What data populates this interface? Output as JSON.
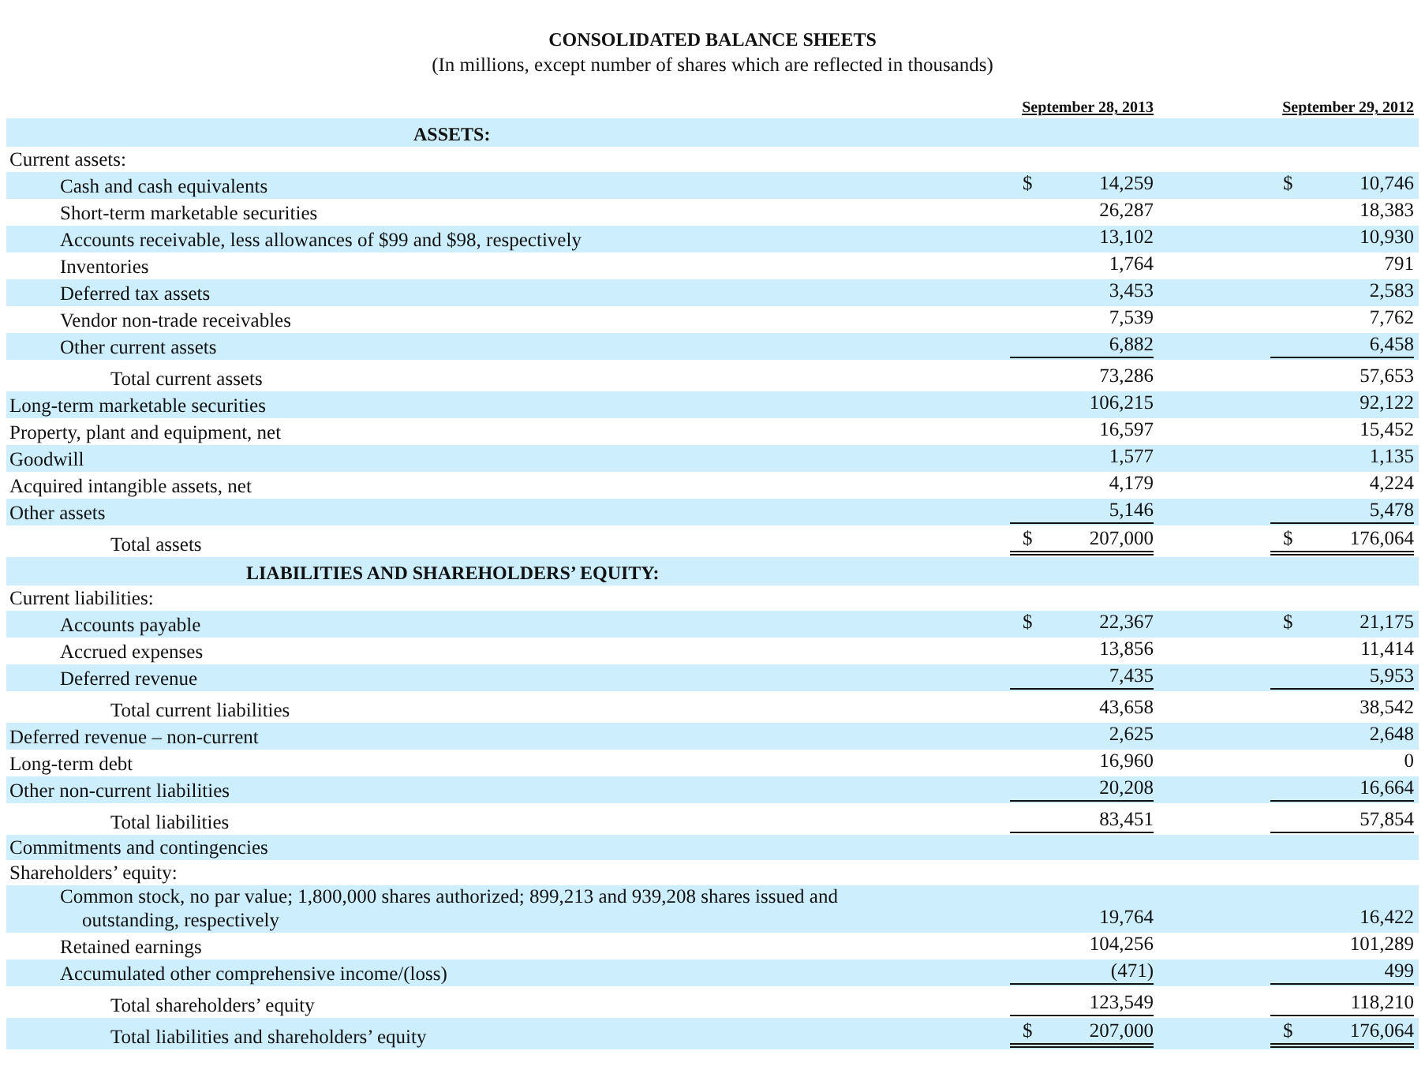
{
  "title": "CONSOLIDATED BALANCE SHEETS",
  "subtitle": "(In millions, except number of shares which are reflected in thousands)",
  "columns": [
    "September 28, 2013",
    "September 29, 2012"
  ],
  "rows": [
    {
      "kind": "section",
      "label": "ASSETS:"
    },
    {
      "kind": "group",
      "label": "Current assets:",
      "children": [
        {
          "kind": "line",
          "label": "Cash and cash equivalents",
          "underlined": false,
          "double_underlined": false,
          "values": [
            {
              "symbol": "$",
              "amount": "14,259"
            },
            {
              "symbol": "$",
              "amount": "10,746"
            }
          ]
        },
        {
          "kind": "line",
          "label": "Short-term marketable securities",
          "underlined": false,
          "double_underlined": false,
          "values": [
            {
              "amount": "26,287"
            },
            {
              "amount": "18,383"
            }
          ]
        },
        {
          "kind": "line",
          "label": "Accounts receivable, less allowances of $99 and $98, respectively",
          "underlined": false,
          "double_underlined": false,
          "values": [
            {
              "amount": "13,102"
            },
            {
              "amount": "10,930"
            }
          ]
        },
        {
          "kind": "line",
          "label": "Inventories",
          "underlined": false,
          "double_underlined": false,
          "values": [
            {
              "amount": "1,764"
            },
            {
              "amount": "791"
            }
          ]
        },
        {
          "kind": "line",
          "label": "Deferred tax assets",
          "underlined": false,
          "double_underlined": false,
          "values": [
            {
              "amount": "3,453"
            },
            {
              "amount": "2,583"
            }
          ]
        },
        {
          "kind": "line",
          "label": "Vendor non-trade receivables",
          "underlined": false,
          "double_underlined": false,
          "values": [
            {
              "amount": "7,539"
            },
            {
              "amount": "7,762"
            }
          ]
        },
        {
          "kind": "line",
          "label": "Other current assets",
          "underlined": true,
          "double_underlined": false,
          "values": [
            {
              "amount": "6,882"
            },
            {
              "amount": "6,458"
            }
          ]
        }
      ]
    },
    {
      "kind": "total",
      "label": "Total current assets",
      "underlined": false,
      "double_underlined": false,
      "values": [
        {
          "amount": "73,286"
        },
        {
          "amount": "57,653"
        }
      ]
    },
    {
      "kind": "line",
      "label": "Long-term marketable securities",
      "underlined": false,
      "double_underlined": false,
      "values": [
        {
          "amount": "106,215"
        },
        {
          "amount": "92,122"
        }
      ]
    },
    {
      "kind": "line",
      "label": "Property, plant and equipment, net",
      "underlined": false,
      "double_underlined": false,
      "values": [
        {
          "amount": "16,597"
        },
        {
          "amount": "15,452"
        }
      ]
    },
    {
      "kind": "line",
      "label": "Goodwill",
      "underlined": false,
      "double_underlined": false,
      "values": [
        {
          "amount": "1,577"
        },
        {
          "amount": "1,135"
        }
      ]
    },
    {
      "kind": "line",
      "label": "Acquired intangible assets, net",
      "underlined": false,
      "double_underlined": false,
      "values": [
        {
          "amount": "4,179"
        },
        {
          "amount": "4,224"
        }
      ]
    },
    {
      "kind": "line",
      "label": "Other assets",
      "underlined": true,
      "double_underlined": false,
      "values": [
        {
          "amount": "5,146"
        },
        {
          "amount": "5,478"
        }
      ]
    },
    {
      "kind": "total",
      "label": "Total assets",
      "underlined": false,
      "double_underlined": true,
      "values": [
        {
          "symbol": "$",
          "amount": "207,000"
        },
        {
          "symbol": "$",
          "amount": "176,064"
        }
      ]
    },
    {
      "kind": "section",
      "label": "LIABILITIES AND SHAREHOLDERS’ EQUITY:"
    },
    {
      "kind": "group",
      "label": "Current liabilities:",
      "children": [
        {
          "kind": "line",
          "label": "Accounts payable",
          "underlined": false,
          "double_underlined": false,
          "values": [
            {
              "symbol": "$",
              "amount": "22,367"
            },
            {
              "symbol": "$",
              "amount": "21,175"
            }
          ]
        },
        {
          "kind": "line",
          "label": "Accrued expenses",
          "underlined": false,
          "double_underlined": false,
          "values": [
            {
              "amount": "13,856"
            },
            {
              "amount": "11,414"
            }
          ]
        },
        {
          "kind": "line",
          "label": "Deferred revenue",
          "underlined": true,
          "double_underlined": false,
          "values": [
            {
              "amount": "7,435"
            },
            {
              "amount": "5,953"
            }
          ]
        }
      ]
    },
    {
      "kind": "total",
      "label": "Total current liabilities",
      "underlined": false,
      "double_underlined": false,
      "values": [
        {
          "amount": "43,658"
        },
        {
          "amount": "38,542"
        }
      ]
    },
    {
      "kind": "line",
      "label": "Deferred revenue – non-current",
      "underlined": false,
      "double_underlined": false,
      "values": [
        {
          "amount": "2,625"
        },
        {
          "amount": "2,648"
        }
      ]
    },
    {
      "kind": "line",
      "label": "Long-term debt",
      "underlined": false,
      "double_underlined": false,
      "values": [
        {
          "amount": "16,960"
        },
        {
          "amount": "0"
        }
      ]
    },
    {
      "kind": "line",
      "label": "Other non-current liabilities",
      "underlined": true,
      "double_underlined": false,
      "values": [
        {
          "amount": "20,208"
        },
        {
          "amount": "16,664"
        }
      ]
    },
    {
      "kind": "total",
      "label": "Total liabilities",
      "underlined": true,
      "double_underlined": false,
      "values": [
        {
          "amount": "83,451"
        },
        {
          "amount": "57,854"
        }
      ]
    },
    {
      "kind": "line",
      "label": "Commitments and contingencies"
    },
    {
      "kind": "group",
      "label": "Shareholders’ equity:",
      "children": [
        {
          "kind": "line",
          "label": "Common stock, no par value; 1,800,000 shares authorized; 899,213 and 939,208 shares issued and outstanding, respectively",
          "underlined": false,
          "double_underlined": false,
          "values": [
            {
              "amount": "19,764"
            },
            {
              "amount": "16,422"
            }
          ]
        },
        {
          "kind": "line",
          "label": "Retained earnings",
          "underlined": false,
          "double_underlined": false,
          "values": [
            {
              "amount": "104,256"
            },
            {
              "amount": "101,289"
            }
          ]
        },
        {
          "kind": "line",
          "label": "Accumulated other comprehensive income/(loss)",
          "underlined": true,
          "double_underlined": false,
          "values": [
            {
              "amount": "(471)"
            },
            {
              "amount": "499"
            }
          ]
        }
      ]
    },
    {
      "kind": "total",
      "label": "Total shareholders’ equity",
      "underlined": true,
      "double_underlined": false,
      "values": [
        {
          "amount": "123,549"
        },
        {
          "amount": "118,210"
        }
      ]
    },
    {
      "kind": "total",
      "label": "Total liabilities and shareholders’ equity",
      "underlined": false,
      "double_underlined": true,
      "values": [
        {
          "symbol": "$",
          "amount": "207,000"
        },
        {
          "symbol": "$",
          "amount": "176,064"
        }
      ]
    }
  ]
}
